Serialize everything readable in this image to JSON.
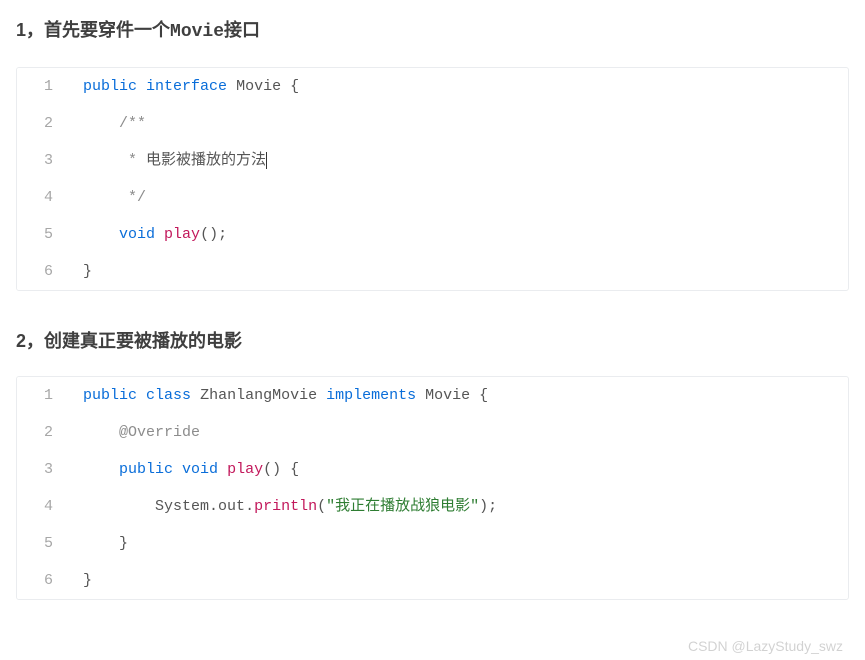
{
  "sections": [
    {
      "heading_prefix": "1，首先要穿件一个",
      "heading_mono": "Movie",
      "heading_suffix": "接口",
      "lines": [
        {
          "n": "1",
          "tokens": [
            {
              "cls": "kw",
              "t": "public"
            },
            {
              "cls": "",
              "t": " "
            },
            {
              "cls": "kw",
              "t": "interface"
            },
            {
              "cls": "",
              "t": " "
            },
            {
              "cls": "type",
              "t": "Movie"
            },
            {
              "cls": "",
              "t": " "
            },
            {
              "cls": "punct",
              "t": "{"
            }
          ]
        },
        {
          "n": "2",
          "tokens": [
            {
              "cls": "",
              "t": "    "
            },
            {
              "cls": "ann",
              "t": "/**"
            }
          ]
        },
        {
          "n": "3",
          "tokens": [
            {
              "cls": "",
              "t": "     "
            },
            {
              "cls": "ann",
              "t": "* "
            },
            {
              "cls": "type",
              "t": "电影被播放的方法"
            },
            {
              "cls": "cursor",
              "t": ""
            }
          ]
        },
        {
          "n": "4",
          "tokens": [
            {
              "cls": "",
              "t": "     "
            },
            {
              "cls": "ann",
              "t": "*/"
            }
          ]
        },
        {
          "n": "5",
          "tokens": [
            {
              "cls": "",
              "t": "    "
            },
            {
              "cls": "kw",
              "t": "void"
            },
            {
              "cls": "",
              "t": " "
            },
            {
              "cls": "fn",
              "t": "play"
            },
            {
              "cls": "punct",
              "t": "();"
            }
          ]
        },
        {
          "n": "6",
          "tokens": [
            {
              "cls": "punct",
              "t": "}"
            }
          ]
        }
      ]
    },
    {
      "heading_prefix": "2，创建真正要被播放的电影",
      "heading_mono": "",
      "heading_suffix": "",
      "lines": [
        {
          "n": "1",
          "tokens": [
            {
              "cls": "kw",
              "t": "public"
            },
            {
              "cls": "",
              "t": " "
            },
            {
              "cls": "kw",
              "t": "class"
            },
            {
              "cls": "",
              "t": " "
            },
            {
              "cls": "type",
              "t": "ZhanlangMovie"
            },
            {
              "cls": "",
              "t": " "
            },
            {
              "cls": "kw",
              "t": "implements"
            },
            {
              "cls": "",
              "t": " "
            },
            {
              "cls": "type",
              "t": "Movie"
            },
            {
              "cls": "",
              "t": " "
            },
            {
              "cls": "punct",
              "t": "{"
            }
          ]
        },
        {
          "n": "2",
          "tokens": [
            {
              "cls": "",
              "t": "    "
            },
            {
              "cls": "ann",
              "t": "@Override"
            }
          ]
        },
        {
          "n": "3",
          "tokens": [
            {
              "cls": "",
              "t": "    "
            },
            {
              "cls": "kw",
              "t": "public"
            },
            {
              "cls": "",
              "t": " "
            },
            {
              "cls": "kw",
              "t": "void"
            },
            {
              "cls": "",
              "t": " "
            },
            {
              "cls": "fn",
              "t": "play"
            },
            {
              "cls": "punct",
              "t": "() {"
            }
          ]
        },
        {
          "n": "4",
          "tokens": [
            {
              "cls": "",
              "t": "        "
            },
            {
              "cls": "type",
              "t": "System"
            },
            {
              "cls": "punct",
              "t": "."
            },
            {
              "cls": "type",
              "t": "out"
            },
            {
              "cls": "punct",
              "t": "."
            },
            {
              "cls": "fn",
              "t": "println"
            },
            {
              "cls": "punct",
              "t": "("
            },
            {
              "cls": "str",
              "t": "\"我正在播放战狼电影\""
            },
            {
              "cls": "punct",
              "t": ");"
            }
          ]
        },
        {
          "n": "5",
          "tokens": [
            {
              "cls": "",
              "t": "    "
            },
            {
              "cls": "punct",
              "t": "}"
            }
          ]
        },
        {
          "n": "6",
          "tokens": [
            {
              "cls": "punct",
              "t": "}"
            }
          ]
        }
      ]
    }
  ],
  "watermark": "CSDN @LazyStudy_swz"
}
